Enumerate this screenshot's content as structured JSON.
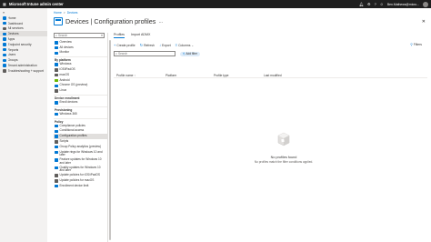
{
  "topbar": {
    "title": "Microsoft Intune admin center",
    "user": "Ben.Mathews@micro..."
  },
  "leftnav": {
    "collapse": "«",
    "items": [
      {
        "label": "Home",
        "color": "#0078d4",
        "active": false
      },
      {
        "label": "Dashboard",
        "color": "#0078d4",
        "active": false
      },
      {
        "label": "All services",
        "color": "#605e5c",
        "active": false
      },
      {
        "label": "Devices",
        "color": "#0078d4",
        "active": true
      },
      {
        "label": "Apps",
        "color": "#0078d4",
        "active": false
      },
      {
        "label": "Endpoint security",
        "color": "#0078d4",
        "active": false
      },
      {
        "label": "Reports",
        "color": "#0078d4",
        "active": false
      },
      {
        "label": "Users",
        "color": "#0078d4",
        "active": false
      },
      {
        "label": "Groups",
        "color": "#0078d4",
        "active": false
      },
      {
        "label": "Tenant administration",
        "color": "#0078d4",
        "active": false
      },
      {
        "label": "Troubleshooting + support",
        "color": "#605e5c",
        "active": false
      }
    ]
  },
  "breadcrumb": {
    "home": "Home",
    "sep": ">",
    "devices": "Devices"
  },
  "header": {
    "title": "Devices | Configuration profiles",
    "more": "…",
    "close": "✕"
  },
  "panel": {
    "search_placeholder": "Search",
    "collapse": "«",
    "top_items": [
      {
        "label": "Overview",
        "color": "#0078d4"
      },
      {
        "label": "All devices",
        "color": "#0078d4"
      },
      {
        "label": "Monitor",
        "color": "#0078d4"
      }
    ],
    "sec_platform": "By platform",
    "platform_items": [
      {
        "label": "Windows",
        "color": "#0078d4"
      },
      {
        "label": "iOS/iPadOS",
        "color": "#605e5c"
      },
      {
        "label": "macOS",
        "color": "#605e5c"
      },
      {
        "label": "Android",
        "color": "#6bb700"
      },
      {
        "label": "Chrome OS (preview)",
        "color": "#0078d4"
      },
      {
        "label": "Linux",
        "color": "#605e5c"
      }
    ],
    "sec_enrollment": "Device enrollment",
    "enrollment_items": [
      {
        "label": "Enroll devices",
        "color": "#0078d4"
      }
    ],
    "sec_provisioning": "Provisioning",
    "provisioning_items": [
      {
        "label": "Windows 365",
        "color": "#0078d4"
      }
    ],
    "sec_policy": "Policy",
    "policy_items": [
      {
        "label": "Compliance policies",
        "color": "#0078d4",
        "active": false
      },
      {
        "label": "Conditional access",
        "color": "#0078d4",
        "active": false
      },
      {
        "label": "Configuration profiles",
        "color": "#0078d4",
        "active": true
      },
      {
        "label": "Scripts",
        "color": "#605e5c",
        "active": false
      },
      {
        "label": "Group Policy analytics (preview)",
        "color": "#0078d4",
        "active": false
      },
      {
        "label": "Update rings for Windows 10 and later",
        "color": "#0078d4",
        "active": false
      },
      {
        "label": "Feature updates for Windows 10 and later",
        "color": "#0078d4",
        "active": false
      },
      {
        "label": "Quality updates for Windows 10 and later",
        "color": "#0078d4",
        "active": false
      },
      {
        "label": "Update policies for iOS/iPadOS",
        "color": "#605e5c",
        "active": false
      },
      {
        "label": "Update policies for macOS",
        "color": "#605e5c",
        "active": false
      },
      {
        "label": "Enrollment device limit",
        "color": "#0078d4",
        "active": false
      }
    ]
  },
  "content": {
    "tabs": [
      {
        "label": "Profiles",
        "active": true
      },
      {
        "label": "Import ADMX",
        "active": false
      }
    ],
    "toolbar": {
      "create": "Create profile",
      "refresh": "Refresh",
      "export": "Export",
      "columns": "Columns",
      "filters": "Filters"
    },
    "search_placeholder": "Search",
    "add_filter": "Add filter",
    "columns": {
      "name": "Profile name ↑",
      "platform": "Platform",
      "type": "Profile type",
      "modified": "Last modified"
    },
    "empty_title": "No profiles found",
    "empty_sub": "No profiles match the filter conditions applied."
  }
}
